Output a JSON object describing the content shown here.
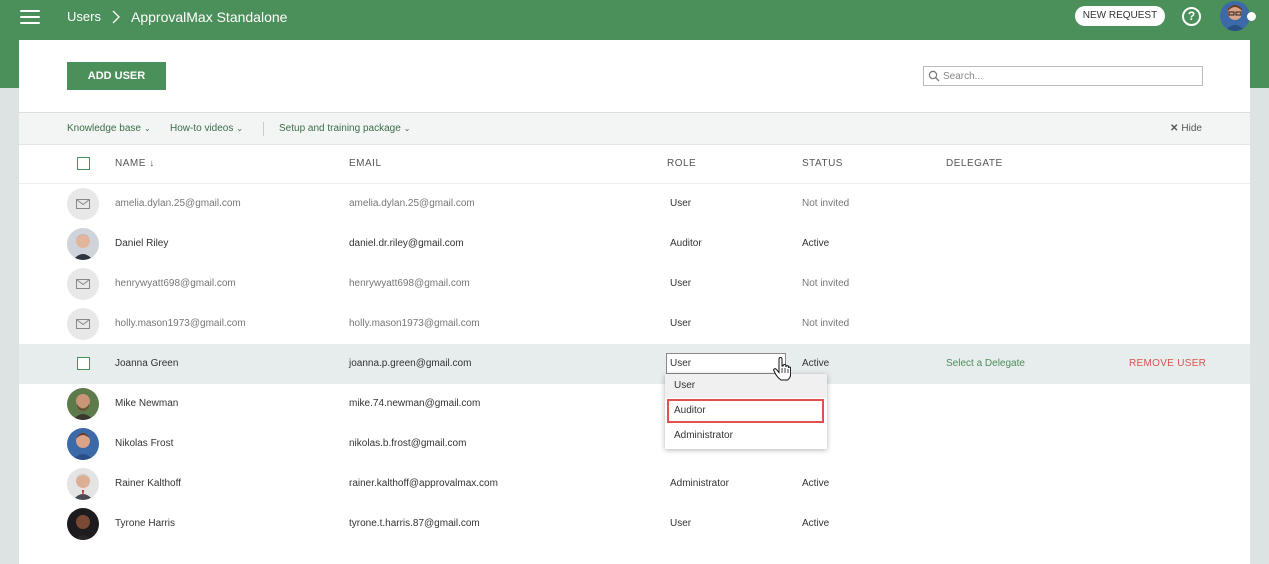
{
  "header": {
    "breadcrumb_users": "Users",
    "breadcrumb_app": "ApprovalMax Standalone",
    "new_request": "NEW REQUEST",
    "help": "?"
  },
  "toolbar": {
    "add_user": "ADD USER",
    "search_placeholder": "Search...",
    "knowledge_base": "Knowledge base",
    "howto_videos": "How-to videos",
    "setup_package": "Setup and training package",
    "hide": "Hide"
  },
  "table": {
    "headers": {
      "name": "NAME",
      "email": "EMAIL",
      "role": "ROLE",
      "status": "STATUS",
      "delegate": "DELEGATE"
    },
    "rows": [
      {
        "name": "amelia.dylan.25@gmail.com",
        "email": "amelia.dylan.25@gmail.com",
        "role": "User",
        "status": "Not invited",
        "avatar": "mail-icon"
      },
      {
        "name": "Daniel Riley",
        "email": "daniel.dr.riley@gmail.com",
        "role": "Auditor",
        "status": "Active",
        "avatar": "photo"
      },
      {
        "name": "henrywyatt698@gmail.com",
        "email": "henrywyatt698@gmail.com",
        "role": "User",
        "status": "Not invited",
        "avatar": "mail-icon"
      },
      {
        "name": "holly.mason1973@gmail.com",
        "email": "holly.mason1973@gmail.com",
        "role": "User",
        "status": "Not invited",
        "avatar": "mail-icon"
      },
      {
        "name": "Joanna Green",
        "email": "joanna.p.green@gmail.com",
        "role": "User",
        "status": "Active",
        "avatar": "none",
        "delegate": "Select a Delegate",
        "remove": "REMOVE USER"
      },
      {
        "name": "Mike Newman",
        "email": "mike.74.newman@gmail.com",
        "role": "",
        "status": "",
        "avatar": "photo"
      },
      {
        "name": "Nikolas Frost",
        "email": "nikolas.b.frost@gmail.com",
        "role": "",
        "status": "",
        "avatar": "photo"
      },
      {
        "name": "Rainer Kalthoff",
        "email": "rainer.kalthoff@approvalmax.com",
        "role": "Administrator",
        "status": "Active",
        "avatar": "photo"
      },
      {
        "name": "Tyrone Harris",
        "email": "tyrone.t.harris.87@gmail.com",
        "role": "User",
        "status": "Active",
        "avatar": "photo"
      }
    ]
  },
  "role_dropdown": {
    "options": [
      "User",
      "Auditor",
      "Administrator"
    ],
    "highlighted": "Auditor"
  },
  "colors": {
    "brand_green": "#4b8f5a",
    "remove_red": "#d9534f",
    "highlight_outline": "#e0504f"
  }
}
